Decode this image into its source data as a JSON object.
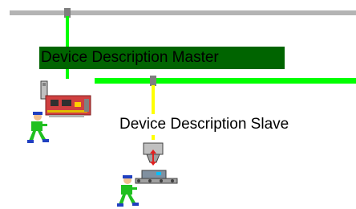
{
  "network": {
    "master": {
      "label": "Device Description Master",
      "device_icon": "network-card-icon",
      "status_icon": "worker-icon"
    },
    "slave": {
      "label": "Device Description Slave",
      "device_icon": "valve-conveyor-icon",
      "status_icon": "worker-icon"
    }
  },
  "colors": {
    "main_bus": "#b4b4b4",
    "master_bus": "#00ff00",
    "slave_drop": "#ffff00",
    "selection_highlight": "#006400",
    "tap": "#7f7f7f"
  }
}
